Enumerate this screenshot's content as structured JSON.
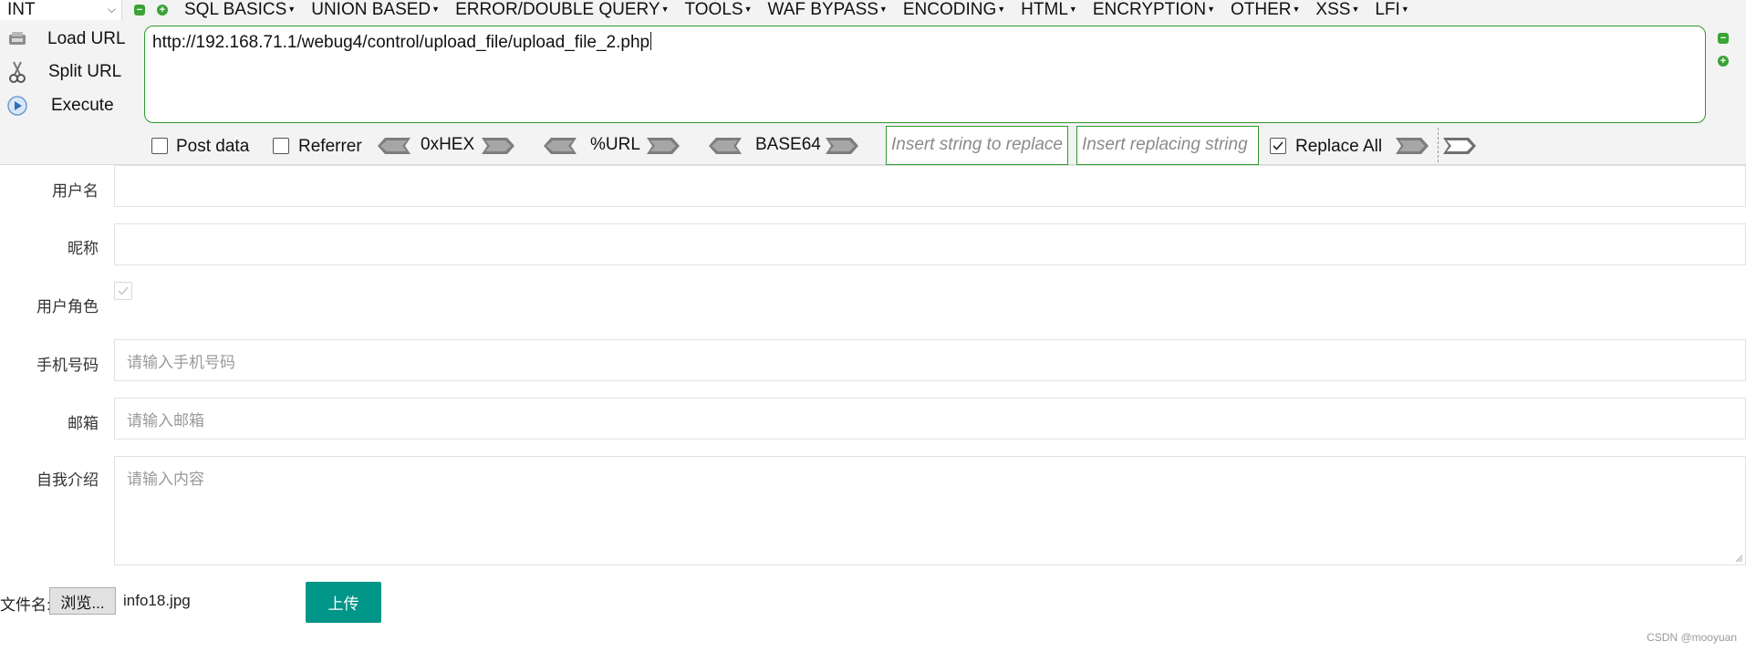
{
  "hackbar": {
    "type_select": "INT",
    "menus": [
      "SQL BASICS",
      "UNION BASED",
      "ERROR/DOUBLE QUERY",
      "TOOLS",
      "WAF BYPASS",
      "ENCODING",
      "HTML",
      "ENCRYPTION",
      "OTHER",
      "XSS",
      "LFI"
    ],
    "actions": {
      "load_url": "Load URL",
      "split_url": "Split URL",
      "execute": "Execute"
    },
    "url": "http://192.168.71.1/webug4/control/upload_file/upload_file_2.php",
    "options": {
      "post_data": "Post data",
      "referrer": "Referrer",
      "hex": "0xHEX",
      "url_enc": "%URL",
      "base64": "BASE64",
      "find_placeholder": "Insert string to replace",
      "replace_placeholder": "Insert replacing string",
      "replace_all": "Replace All",
      "replace_all_checked": true,
      "post_data_checked": false,
      "referrer_checked": false
    }
  },
  "form": {
    "username_label": "用户名",
    "username_value": "",
    "nickname_label": "昵称",
    "nickname_value": "",
    "role_label": "用户角色",
    "phone_label": "手机号码",
    "phone_placeholder": "请输入手机号码",
    "email_label": "邮箱",
    "email_placeholder": "请输入邮箱",
    "intro_label": "自我介绍",
    "intro_placeholder": "请输入内容",
    "file_label": "文件名:",
    "browse_label": "浏览...",
    "file_name": "info18.jpg",
    "upload_label": "上传"
  },
  "watermark": "CSDN @mooyuan"
}
